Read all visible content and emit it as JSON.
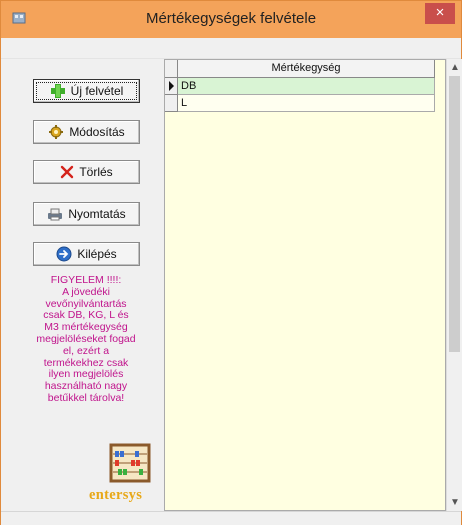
{
  "window": {
    "title": "Mértékegységek felvétele",
    "close_label": "×"
  },
  "buttons": {
    "new": "Új felvétel",
    "edit": "Módosítás",
    "delete": "Törlés",
    "print": "Nyomtatás",
    "exit": "Kilépés"
  },
  "warning": {
    "lines": [
      "FIGYELEM !!!!:",
      "A jövedéki",
      "vevőnyilvántartás",
      "csak DB, KG, L és",
      "M3 mértékegység",
      "megjelöléseket fogad",
      "el, ezért a",
      "termékekhez csak",
      "ilyen megjelölés",
      "használható nagy",
      "betűkkel tárolva!"
    ]
  },
  "brand": "entersys",
  "grid": {
    "column_header": "Mértékegység",
    "rows": [
      "DB",
      "L"
    ],
    "selected_row": 0
  },
  "colors": {
    "titlebar": "#f4a35a",
    "close": "#c94f4b",
    "warning_text": "#c0148c",
    "grid_bg": "#ffffe1",
    "selected_row": "#d9f4d4",
    "brand": "#e8a818"
  }
}
